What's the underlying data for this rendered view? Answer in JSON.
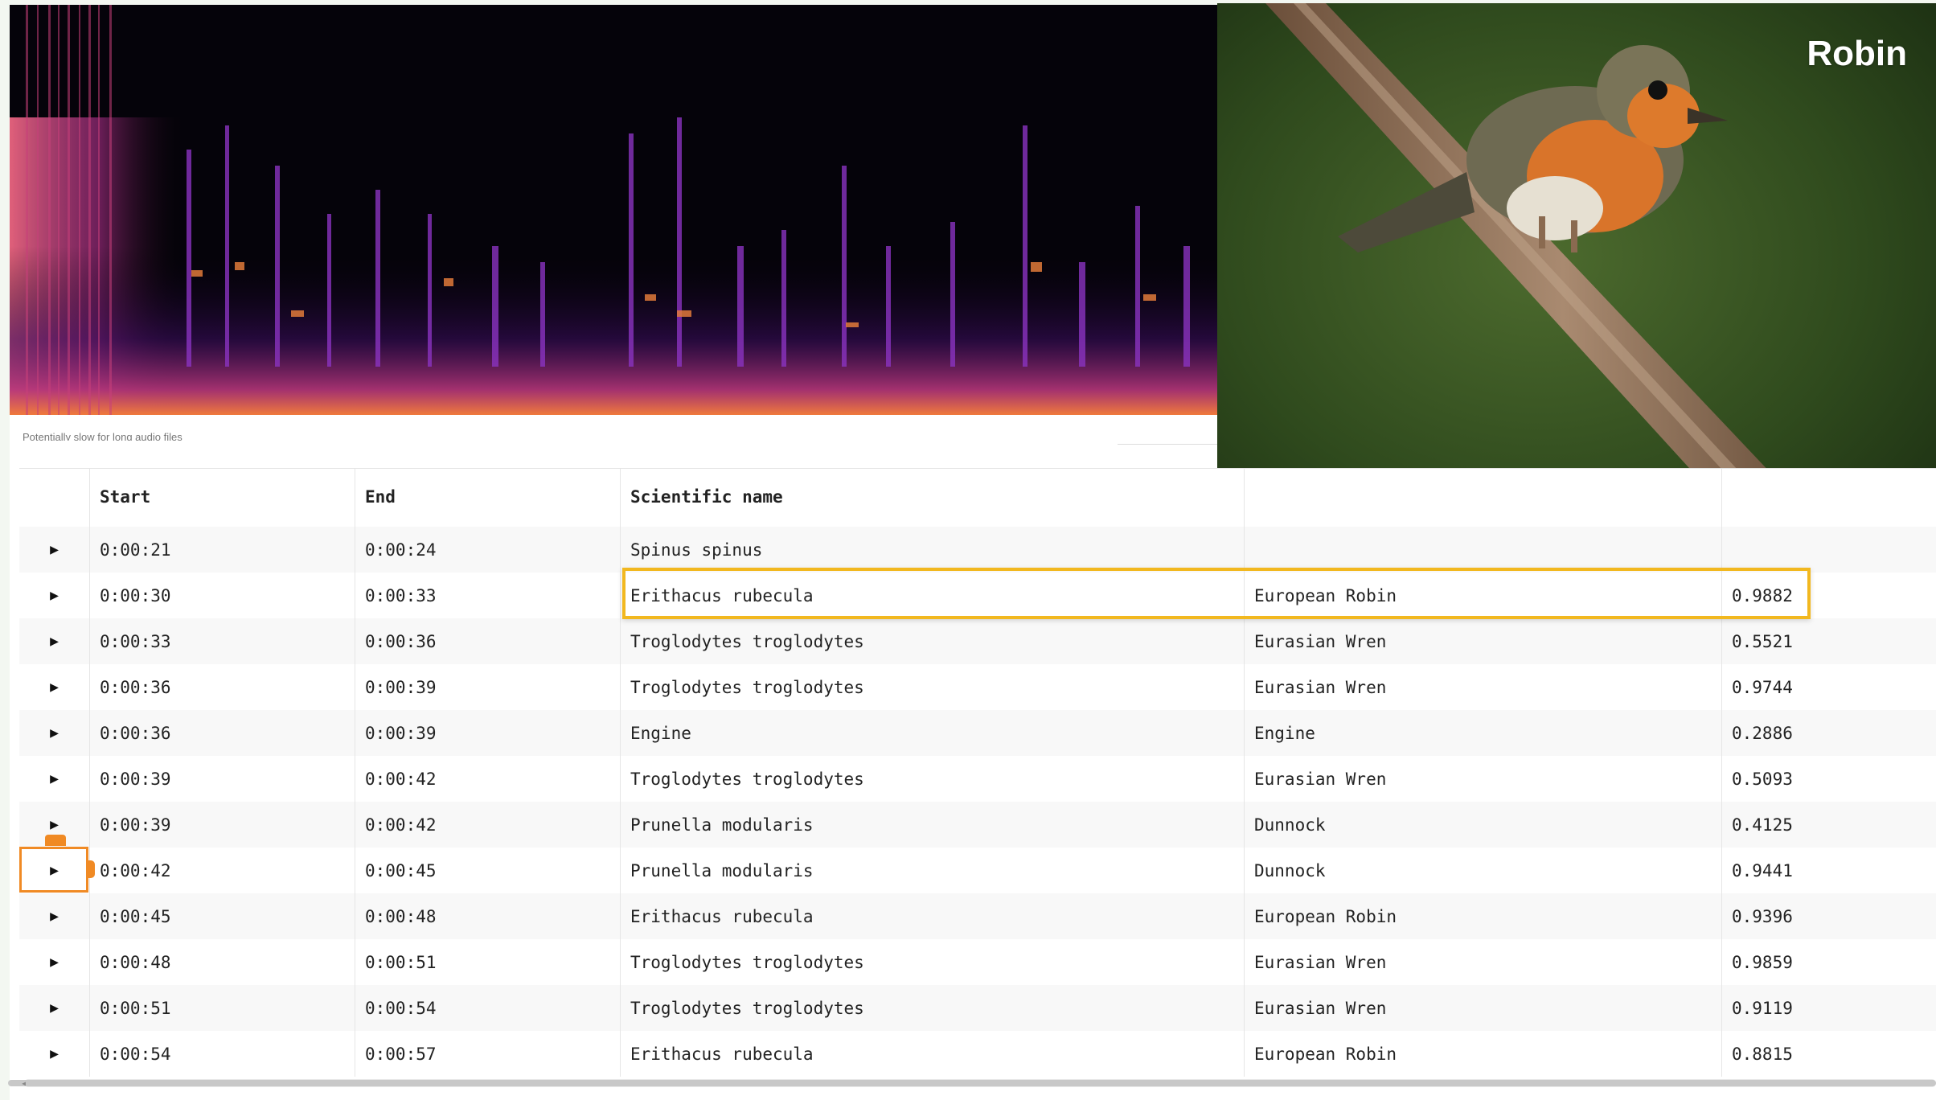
{
  "spectrogram": {
    "caption": "Potentially slow for long audio files"
  },
  "photo": {
    "title": "Robin"
  },
  "table": {
    "headers": {
      "play": "",
      "start": "Start",
      "end": "End",
      "scientific_name": "Scientific name",
      "common_name": "",
      "confidence": ""
    },
    "rows": [
      {
        "start": "0:00:21",
        "end": "0:00:24",
        "scientific": "Spinus spinus",
        "common": "",
        "confidence": ""
      },
      {
        "start": "0:00:30",
        "end": "0:00:33",
        "scientific": "Erithacus rubecula",
        "common": "European Robin",
        "confidence": "0.9882"
      },
      {
        "start": "0:00:33",
        "end": "0:00:36",
        "scientific": "Troglodytes troglodytes",
        "common": "Eurasian Wren",
        "confidence": "0.5521"
      },
      {
        "start": "0:00:36",
        "end": "0:00:39",
        "scientific": "Troglodytes troglodytes",
        "common": "Eurasian Wren",
        "confidence": "0.9744"
      },
      {
        "start": "0:00:36",
        "end": "0:00:39",
        "scientific": "Engine",
        "common": "Engine",
        "confidence": "0.2886"
      },
      {
        "start": "0:00:39",
        "end": "0:00:42",
        "scientific": "Troglodytes troglodytes",
        "common": "Eurasian Wren",
        "confidence": "0.5093"
      },
      {
        "start": "0:00:39",
        "end": "0:00:42",
        "scientific": "Prunella modularis",
        "common": "Dunnock",
        "confidence": "0.4125"
      },
      {
        "start": "0:00:42",
        "end": "0:00:45",
        "scientific": "Prunella modularis",
        "common": "Dunnock",
        "confidence": "0.9441"
      },
      {
        "start": "0:00:45",
        "end": "0:00:48",
        "scientific": "Erithacus rubecula",
        "common": "European Robin",
        "confidence": "0.9396"
      },
      {
        "start": "0:00:48",
        "end": "0:00:51",
        "scientific": "Troglodytes troglodytes",
        "common": "Eurasian Wren",
        "confidence": "0.9859"
      },
      {
        "start": "0:00:51",
        "end": "0:00:54",
        "scientific": "Troglodytes troglodytes",
        "common": "Eurasian Wren",
        "confidence": "0.9119"
      },
      {
        "start": "0:00:54",
        "end": "0:00:57",
        "scientific": "Erithacus rubecula",
        "common": "European Robin",
        "confidence": "0.8815"
      }
    ]
  },
  "icons": {
    "play": "play-icon",
    "scroll_left": "chevron-left-icon"
  },
  "colors": {
    "highlight": "#f2b81f",
    "focus": "#f08a24"
  }
}
